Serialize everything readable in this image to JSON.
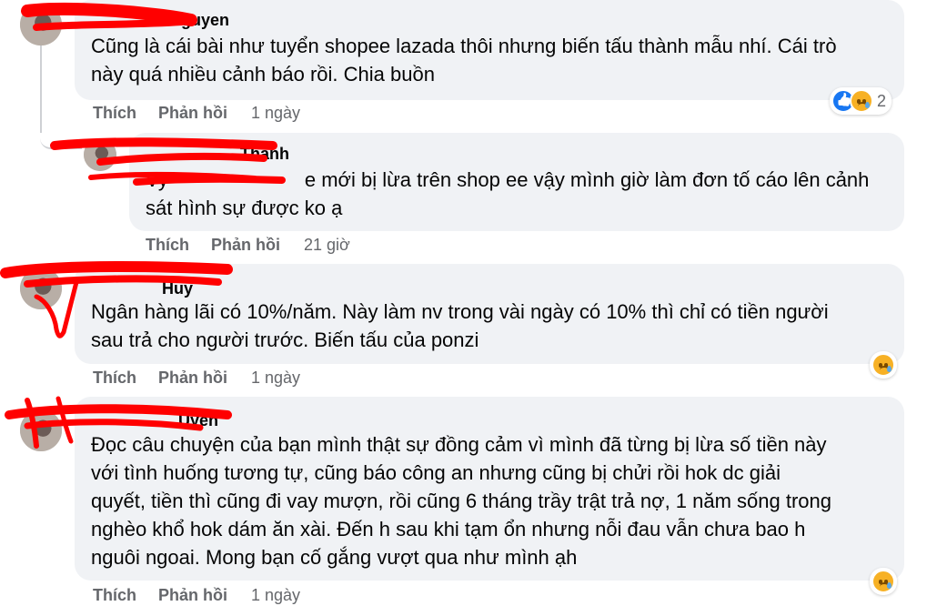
{
  "comments": [
    {
      "name": "Nguyen",
      "lines": [
        "Cũng là cái bài như tuyển shopee lazada thôi nhưng biến tấu thành mẫu nhí. Cái trò",
        "này quá nhiều cảnh báo rồi. Chia buồn"
      ],
      "like": "Thích",
      "reply": "Phản hồi",
      "time": "1 ngày",
      "reaction_count": "2",
      "reactions": [
        "like-icon",
        "sad-icon"
      ]
    },
    {
      "name": "Thanh",
      "lines": [
        "e mới bị lừa trên shop ee vậy mình giờ làm đơn tố cáo lên cảnh",
        "sát hình sự được ko ạ"
      ],
      "line_prefix": "Vy",
      "like": "Thích",
      "reply": "Phản hồi",
      "time": "21 giờ"
    },
    {
      "name": "Huy",
      "lines": [
        "Ngân hàng lãi có 10%/năm. Này làm nv trong vài ngày có 10% thì chỉ có tiền người",
        "sau trả cho người trước. Biến tấu của ponzi"
      ],
      "like": "Thích",
      "reply": "Phản hồi",
      "time": "1 ngày",
      "reactions": [
        "sad-icon"
      ]
    },
    {
      "name": "Uyen",
      "lines": [
        "Đọc câu chuyện của bạn mình thật sự đồng cảm vì mình đã từng bị lừa số tiền này",
        "với tình huống tương tự, cũng báo công an nhưng cũng bị chửi rồi hok dc giải",
        "quyết, tiền thì cũng đi vay mượn, rồi cũng 6 tháng trầy trật trả nợ, 1 năm sống trong",
        "nghèo khổ hok dám ăn xài. Đến h sau khi tạm ổn nhưng nỗi đau vẫn chưa bao h",
        "nguôi ngoai. Mong bạn cố gắng vượt qua như mình ạh"
      ],
      "like": "Thích",
      "reply": "Phản hồi",
      "time": "1 ngày",
      "reactions": [
        "sad-icon"
      ]
    }
  ],
  "colors": {
    "bubble": "#f0f2f5",
    "meta": "#65676b",
    "redaction": "#ff0000"
  }
}
